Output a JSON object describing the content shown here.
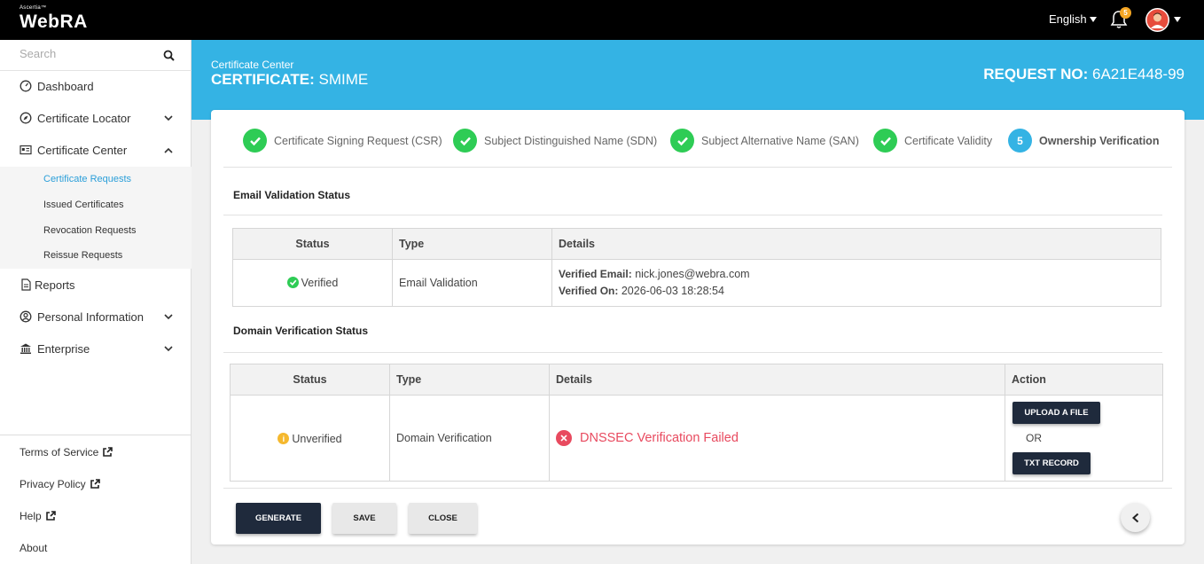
{
  "app": {
    "brand_small": "Ascertia™",
    "brand_name": "WebRA",
    "language": "English",
    "notification_count": "5"
  },
  "search": {
    "placeholder": "Search"
  },
  "sidebar": {
    "items": [
      {
        "label": "Dashboard",
        "icon": "dashboard-icon"
      },
      {
        "label": "Certificate Locator",
        "icon": "compass-icon"
      },
      {
        "label": "Certificate Center",
        "icon": "id-card-icon"
      },
      {
        "label": "Reports",
        "icon": "document-icon"
      },
      {
        "label": "Personal Information",
        "icon": "user-circle-icon"
      },
      {
        "label": "Enterprise",
        "icon": "bank-icon"
      }
    ],
    "sub_items": [
      {
        "label": "Certificate Requests",
        "active": true
      },
      {
        "label": "Issued Certificates"
      },
      {
        "label": "Revocation Requests"
      },
      {
        "label": "Reissue Requests"
      }
    ],
    "footer": [
      {
        "label": "Terms of Service"
      },
      {
        "label": "Privacy Policy"
      },
      {
        "label": "Help"
      },
      {
        "label": "About"
      }
    ]
  },
  "header": {
    "breadcrumb": "Certificate Center",
    "title_label": "CERTIFICATE:",
    "title_value": "SMIME",
    "request_label": "REQUEST NO:",
    "request_value": "6A21E448-99"
  },
  "steps": [
    {
      "label": "Certificate Signing Request (CSR)",
      "state": "done"
    },
    {
      "label": "Subject Distinguished Name (SDN)",
      "state": "done"
    },
    {
      "label": "Subject Alternative Name (SAN)",
      "state": "done"
    },
    {
      "label": "Certificate Validity",
      "state": "done"
    },
    {
      "label": "Ownership Verification",
      "state": "current",
      "number": "5"
    }
  ],
  "email_section": {
    "title": "Email Validation Status",
    "headers": [
      "Status",
      "Type",
      "Details"
    ],
    "row": {
      "status": "Verified",
      "type": "Email Validation",
      "email_label": "Verified Email:",
      "email_value": "nick.jones@webra.com",
      "on_label": "Verified On:",
      "on_value": "2026-06-03 18:28:54"
    }
  },
  "domain_section": {
    "title": "Domain Verification Status",
    "headers": [
      "Status",
      "Type",
      "Details",
      "Action"
    ],
    "row": {
      "status": "Unverified",
      "type": "Domain Verification",
      "details": "DNSSEC Verification Failed",
      "upload_label": "UPLOAD A FILE",
      "or_label": "OR",
      "txt_label": "TXT RECORD"
    }
  },
  "actions": {
    "generate": "GENERATE",
    "save": "SAVE",
    "close": "CLOSE"
  },
  "colors": {
    "accent": "#34b3e4",
    "success": "#2ecc55",
    "error": "#e84a5f",
    "warning": "#f5b82e",
    "dark_button": "#1f2a3c"
  }
}
